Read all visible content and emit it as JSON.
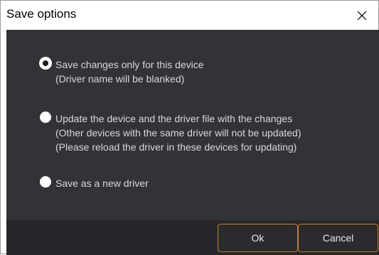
{
  "window": {
    "title": "Save options"
  },
  "options": [
    {
      "line1": "Save changes only for this device",
      "line2": "(Driver name will be blanked)",
      "checked": true
    },
    {
      "line1": "Update the device and the driver file with the changes",
      "line2": "(Other devices with the same driver will not be updated)",
      "line3": "(Please reload the driver in these devices for updating)",
      "checked": false
    },
    {
      "line1": "Save as a new driver",
      "checked": false
    }
  ],
  "buttons": {
    "ok_label": "Ok",
    "cancel_label": "Cancel"
  },
  "colors": {
    "panel_bg": "#323337",
    "footer_bg": "#26272a",
    "button_border": "#c77f1e",
    "text": "#d8d8d8"
  },
  "icons": {
    "close": "close-icon"
  }
}
